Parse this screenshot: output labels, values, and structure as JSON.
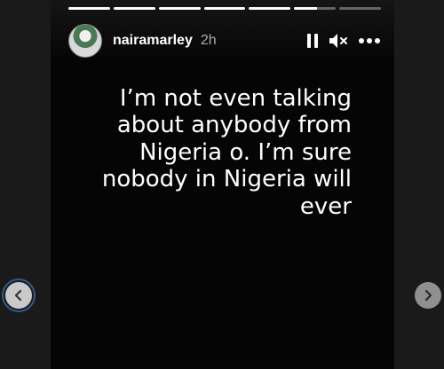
{
  "story": {
    "username": "nairamarley",
    "time": "2h",
    "text": "I’m not even talking\nabout anybody from\nNigeria o. I’m sure\nnobody in Nigeria will\never",
    "segments": [
      1,
      1,
      1,
      1,
      1,
      0.55,
      0
    ],
    "icons": {
      "pause": "pause-icon",
      "mute": "mute-icon",
      "more": "more-options-icon",
      "prev": "chevron-left-icon",
      "next": "chevron-right-icon"
    }
  },
  "colors": {
    "background": "#1a1a1a",
    "story_background": "#050505",
    "text": "#ffffff",
    "focus_ring": "#2d5d8a"
  }
}
